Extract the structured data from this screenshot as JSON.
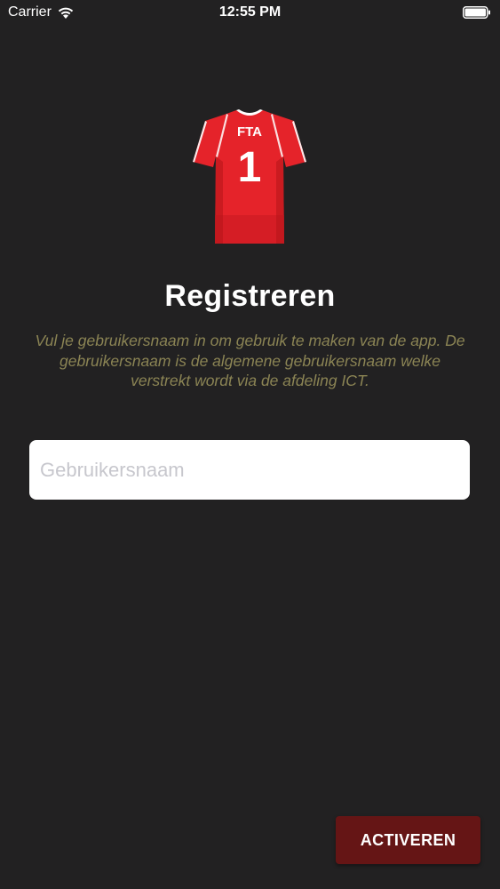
{
  "status_bar": {
    "carrier": "Carrier",
    "time": "12:55 PM",
    "wifi_icon": "wifi-icon",
    "battery_icon": "battery-icon"
  },
  "logo": {
    "icon": "jersey-icon",
    "team_label": "FTA",
    "number": "1",
    "jersey_color": "#e5232a"
  },
  "title": "Registreren",
  "description": "Vul je gebruikersnaam in om gebruik te maken van de app. De gebruikersnaam is de algemene gebruikersnaam welke verstrekt wordt via de afdeling ICT.",
  "username": {
    "value": "",
    "placeholder": "Gebruikersnaam"
  },
  "activate_button": {
    "label": "ACTIVEREN",
    "color": "#651515"
  },
  "colors": {
    "background": "#222122",
    "description_text": "#8b8454"
  }
}
